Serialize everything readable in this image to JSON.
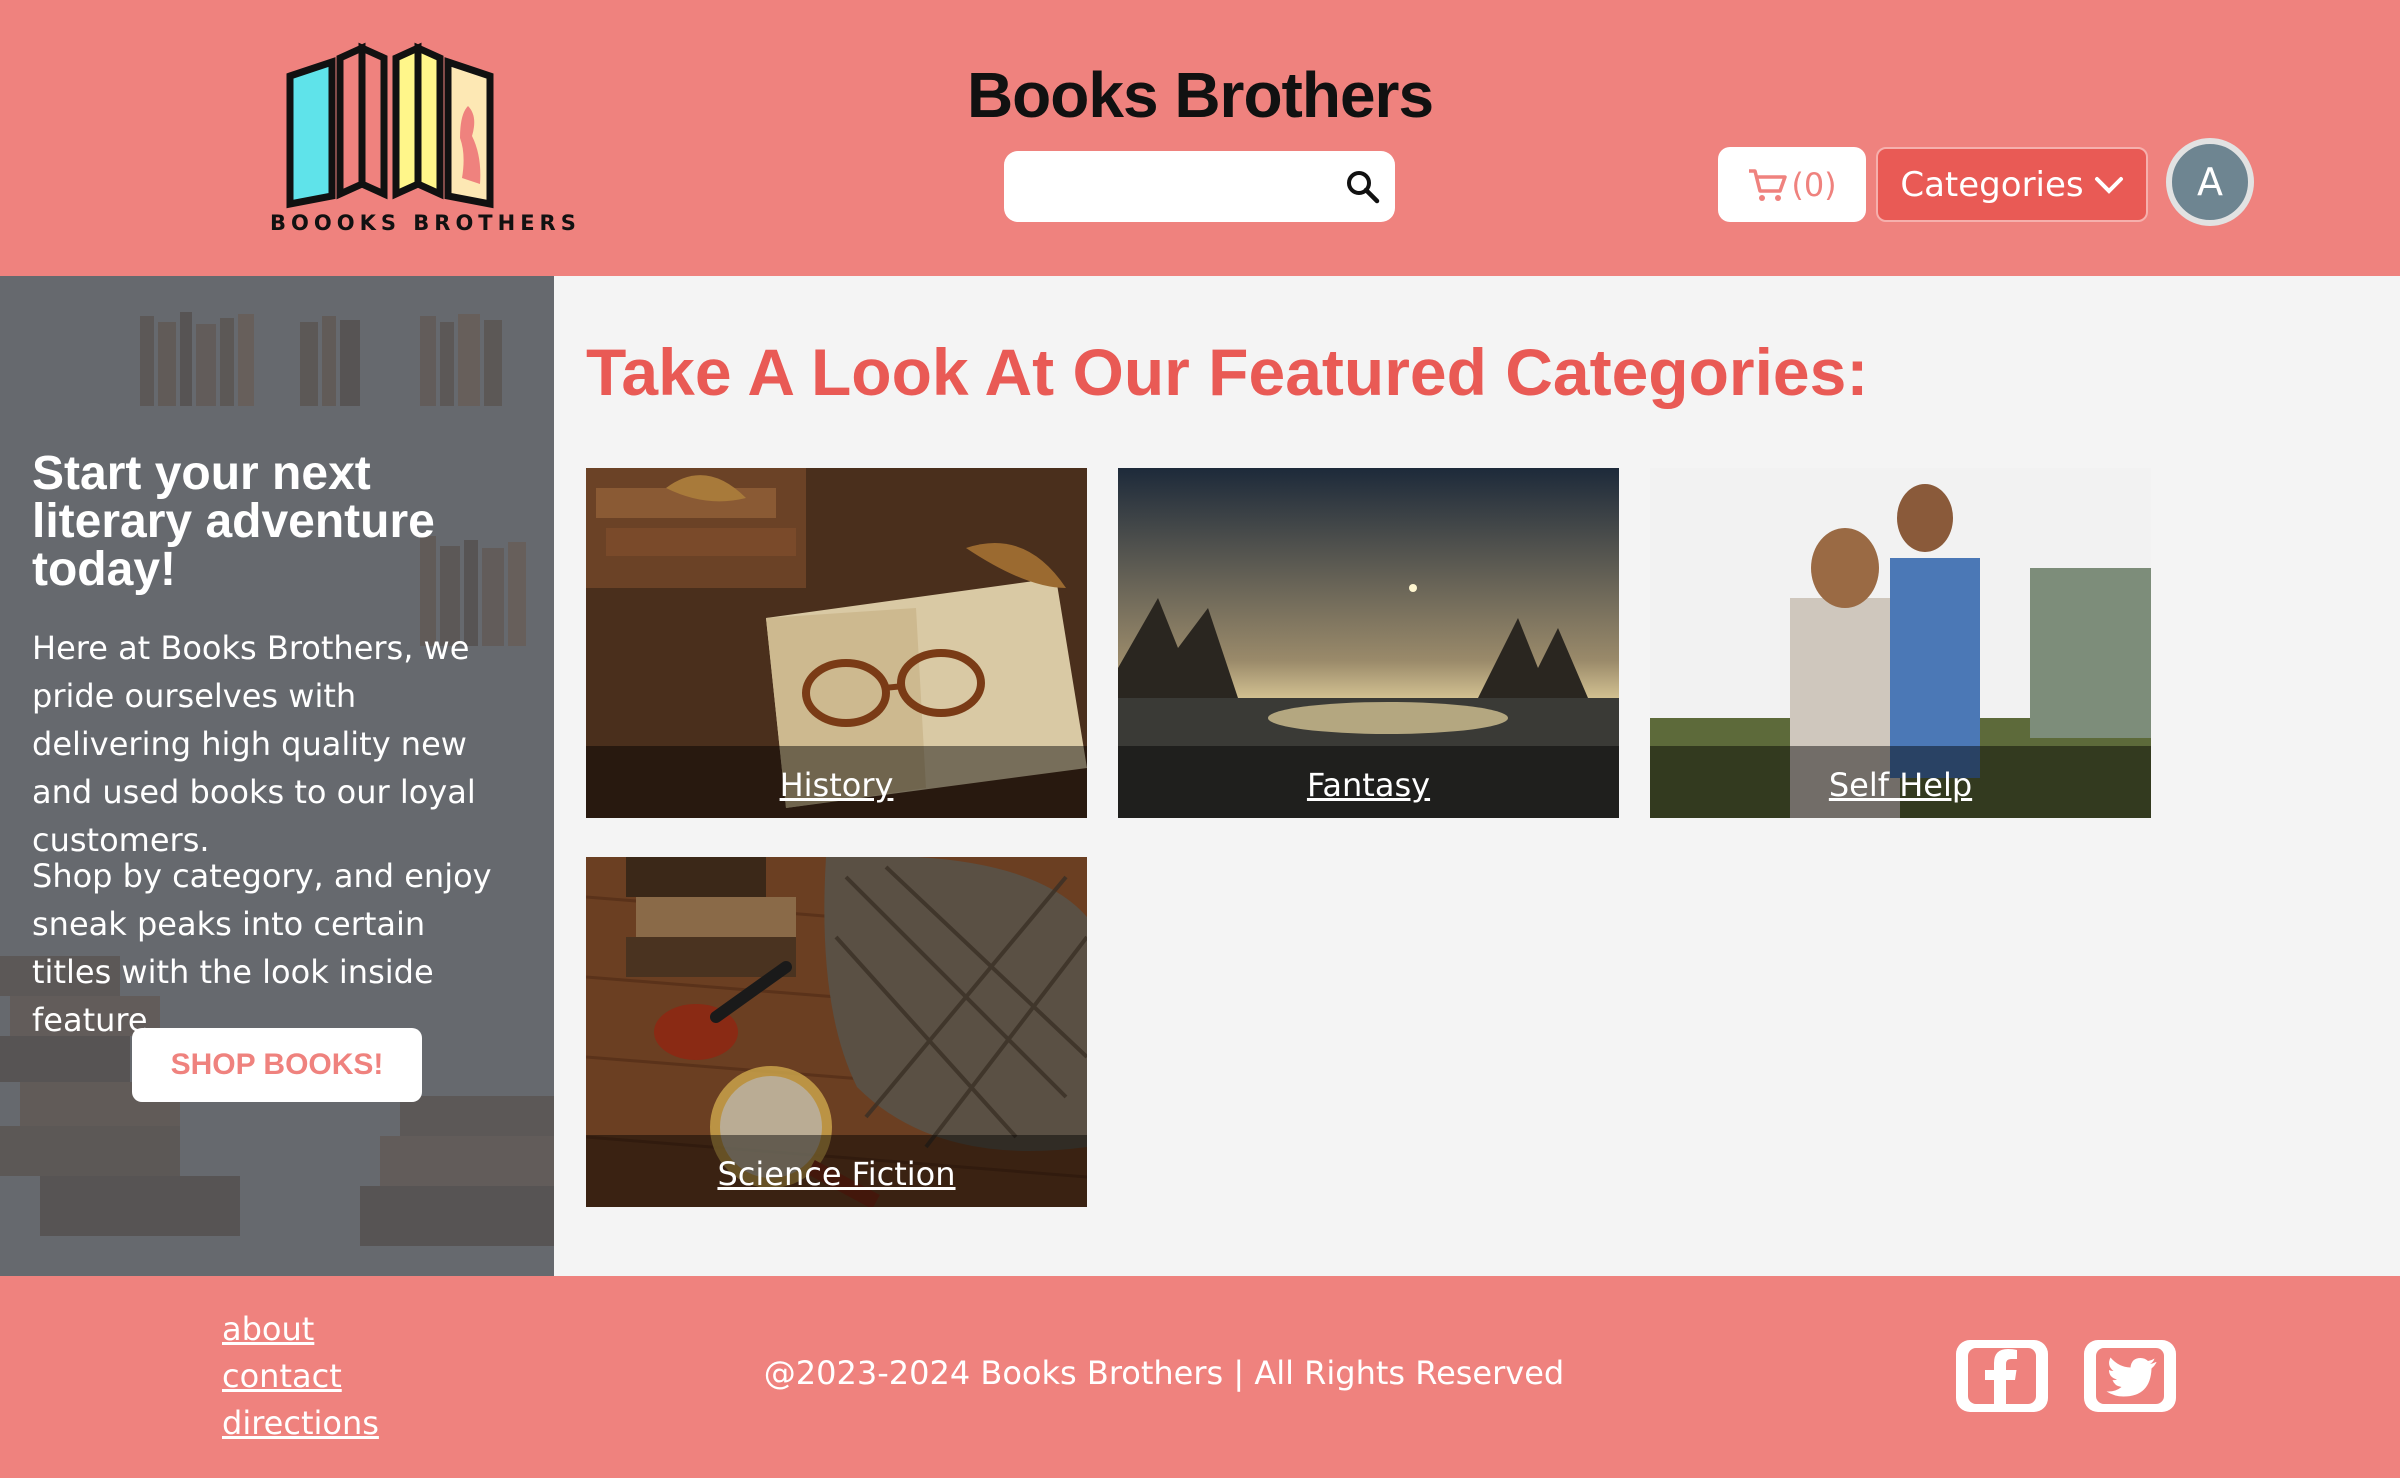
{
  "header": {
    "logo_text": "BOOOKS BROTHERS",
    "site_title": "Books Brothers",
    "search_placeholder": "",
    "cart_count": "(0)",
    "categories_label": "Categories",
    "avatar_initial": "A"
  },
  "sidebar": {
    "title": "Start your next literary adventure today!",
    "paragraph_1": "Here at Books Brothers, we pride ourselves with delivering high quality new and used books to our loyal customers.",
    "paragraph_2": "Shop by category, and enjoy sneak peaks into certain titles with the look inside feature",
    "shop_button": "SHOP BOOKS!"
  },
  "main": {
    "heading": "Take A Look At Our Featured Categories:",
    "categories": [
      {
        "label": "History"
      },
      {
        "label": "Fantasy"
      },
      {
        "label": "Self Help"
      },
      {
        "label": "Science Fiction"
      }
    ]
  },
  "footer": {
    "links": [
      "about",
      "contact",
      "directions"
    ],
    "copyright": "@2023-2024 Books Brothers | All Rights Reserved"
  },
  "colors": {
    "brand_pink": "#ef827e",
    "accent_red": "#e95a55",
    "sidebar_gray": "#6a6d72",
    "main_bg": "#f4f4f4"
  },
  "icons": [
    "logo",
    "search-icon",
    "cart-icon",
    "chevron-down-icon",
    "facebook-icon",
    "twitter-icon"
  ]
}
